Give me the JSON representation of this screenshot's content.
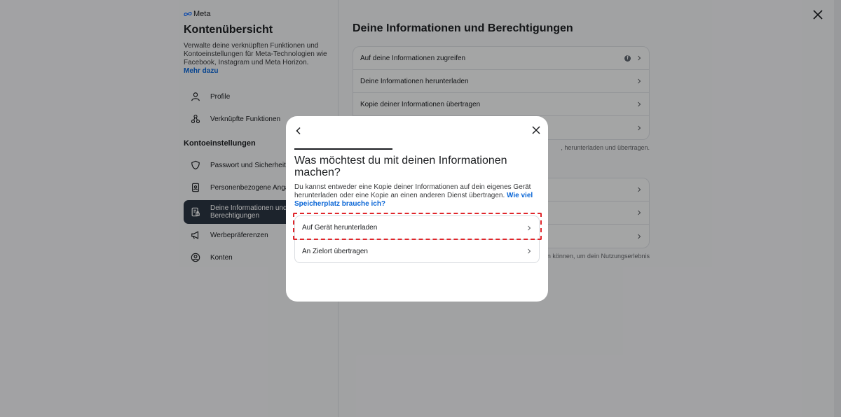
{
  "brand": {
    "logo_text": "Meta"
  },
  "left": {
    "title": "Kontenübersicht",
    "description": "Verwalte deine verknüpften Funktionen und Kontoeinstellungen für Meta-Technologien wie Facebook, Instagram und Meta Horizon.",
    "learn_more": "Mehr dazu",
    "nav": [
      {
        "label": "Profile"
      },
      {
        "label": "Verknüpfte Funktionen"
      }
    ],
    "section_title": "Kontoeinstellungen",
    "settings": [
      {
        "label": "Passwort und Sicherheit"
      },
      {
        "label": "Personenbezogene Angaben"
      },
      {
        "label": "Deine Informationen und Berechtigungen"
      },
      {
        "label": "Werbepräferenzen"
      },
      {
        "label": "Konten"
      }
    ]
  },
  "right": {
    "title": "Deine Informationen und Berechtigungen",
    "card1": [
      {
        "label": "Auf deine Informationen zugreifen"
      },
      {
        "label": "Deine Informationen herunterladen"
      },
      {
        "label": "Kopie deiner Informationen übertragen"
      },
      {
        "label": ""
      }
    ],
    "helper1": ", herunterladen und übertragen.",
    "card2": [
      {
        "label": ""
      },
      {
        "label": ""
      },
      {
        "label": ""
      }
    ],
    "helper2": "en können, um dein Nutzungserlebnis"
  },
  "modal": {
    "title": "Was möchtest du mit deinen Informationen machen?",
    "description": "Du kannst entweder eine Kopie deiner Informationen auf dein eigenes Gerät herunterladen oder eine Kopie an einen anderen Dienst übertragen.",
    "storage_link": "Wie viel Speicherplatz brauche ich?",
    "options": [
      {
        "label": "Auf Gerät herunterladen"
      },
      {
        "label": "An Zielort übertragen"
      }
    ]
  },
  "colors": {
    "accent": "#0a66d6",
    "highlight": "#e0262b",
    "active_nav": "#2b3542"
  }
}
